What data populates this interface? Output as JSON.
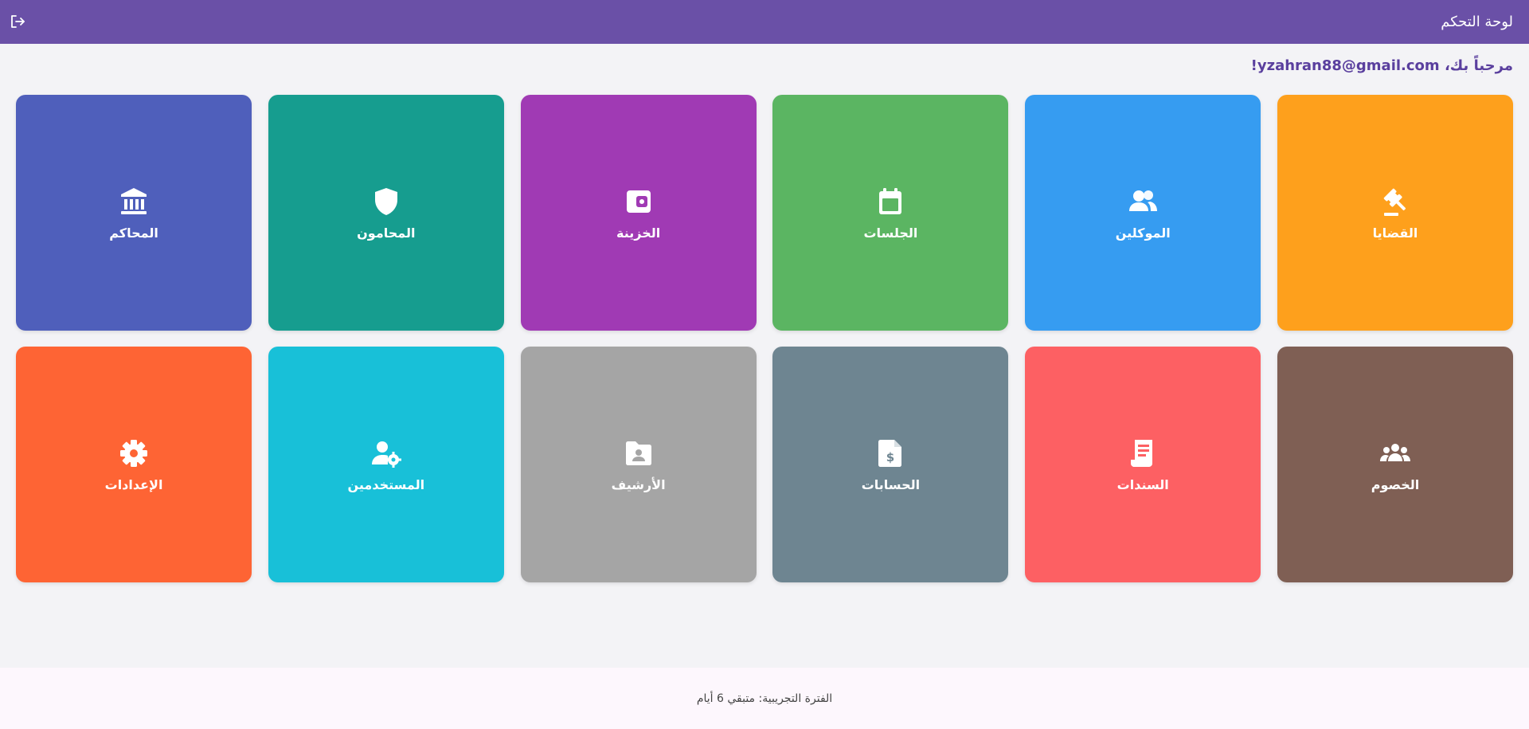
{
  "header": {
    "title": "لوحة التحكم",
    "logout_icon": "logout-icon"
  },
  "welcome": {
    "text": "مرحباً بك، yzahran88@gmail.com!"
  },
  "tiles": [
    {
      "label": "القضايا",
      "icon": "gavel-icon",
      "color": "#fea01c"
    },
    {
      "label": "الموكلين",
      "icon": "users-icon",
      "color": "#369cf1"
    },
    {
      "label": "الجلسات",
      "icon": "calendar-icon",
      "color": "#5bb562"
    },
    {
      "label": "الخزينة",
      "icon": "wallet-icon",
      "color": "#a03ab4"
    },
    {
      "label": "المحامون",
      "icon": "shield-icon",
      "color": "#169d8f"
    },
    {
      "label": "المحاكم",
      "icon": "court-icon",
      "color": "#4f5fbb"
    },
    {
      "label": "الخصوم",
      "icon": "group-icon",
      "color": "#7f5f54"
    },
    {
      "label": "السندات",
      "icon": "receipt-icon",
      "color": "#fd6063"
    },
    {
      "label": "الحسابات",
      "icon": "invoice-dollar-icon",
      "color": "#6e8591"
    },
    {
      "label": "الأرشيف",
      "icon": "folder-user-icon",
      "color": "#a5a5a5"
    },
    {
      "label": "المستخدمين",
      "icon": "user-gear-icon",
      "color": "#18c0d8"
    },
    {
      "label": "الإعدادات",
      "icon": "gear-icon",
      "color": "#fe6434"
    }
  ],
  "footer": {
    "text": "الفترة التجريبية: متبقي 6 أيام"
  }
}
